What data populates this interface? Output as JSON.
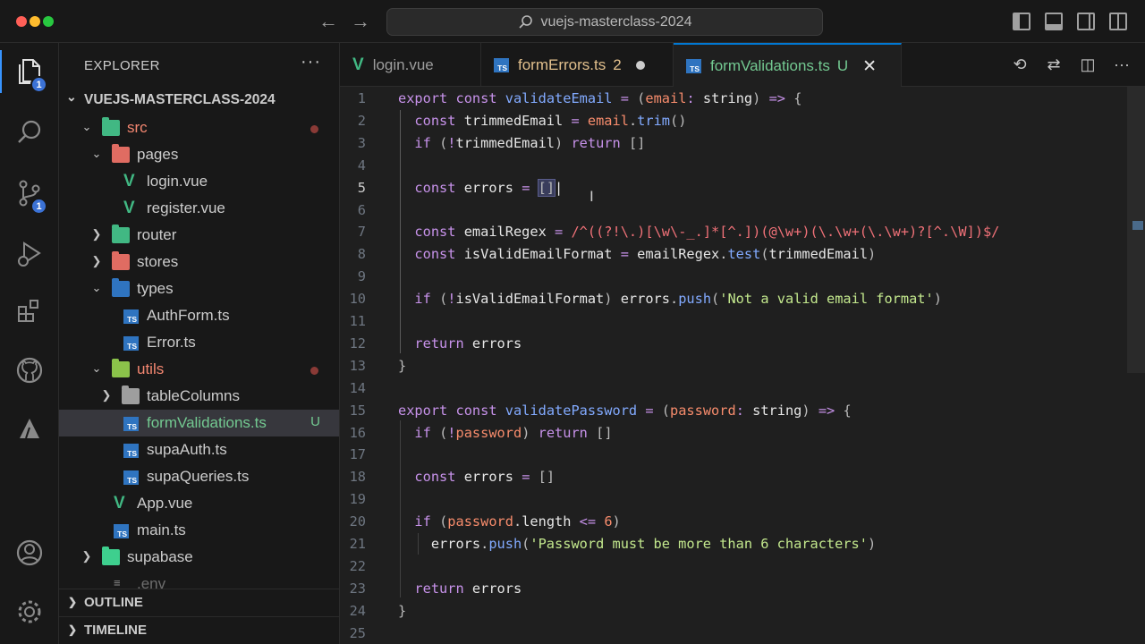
{
  "window": {
    "search_text": "vuejs-masterclass-2024"
  },
  "activity_bar": {
    "explorer_badge": "1",
    "scm_badge": "1"
  },
  "explorer": {
    "title": "EXPLORER",
    "more": "···",
    "root": "VUEJS-MASTERCLASS-2024",
    "items": [
      {
        "label": "src",
        "kind": "folder",
        "expanded": true,
        "color": "#f48771",
        "icon_color": "#41b883"
      },
      {
        "label": "pages",
        "kind": "folder",
        "expanded": true,
        "color": "#cccccc",
        "icon_color": "#e06c62"
      },
      {
        "label": "login.vue",
        "kind": "vue"
      },
      {
        "label": "register.vue",
        "kind": "vue"
      },
      {
        "label": "router",
        "kind": "folder",
        "expanded": false,
        "icon_color": "#41b883"
      },
      {
        "label": "stores",
        "kind": "folder",
        "expanded": false,
        "icon_color": "#e06c62"
      },
      {
        "label": "types",
        "kind": "folder",
        "expanded": true,
        "icon_color": "#2f74c0"
      },
      {
        "label": "AuthForm.ts",
        "kind": "ts"
      },
      {
        "label": "Error.ts",
        "kind": "ts"
      },
      {
        "label": "utils",
        "kind": "folder",
        "expanded": true,
        "color": "#f48771",
        "icon_color": "#8bc34a"
      },
      {
        "label": "tableColumns",
        "kind": "folder",
        "expanded": false,
        "icon_color": "#9e9e9e"
      },
      {
        "label": "formValidations.ts",
        "kind": "ts",
        "status": "U",
        "selected": true
      },
      {
        "label": "supaAuth.ts",
        "kind": "ts"
      },
      {
        "label": "supaQueries.ts",
        "kind": "ts"
      },
      {
        "label": "App.vue",
        "kind": "vue"
      },
      {
        "label": "main.ts",
        "kind": "ts"
      },
      {
        "label": "supabase",
        "kind": "folder",
        "expanded": false,
        "icon_color": "#3ecf8e"
      },
      {
        "label": ".env",
        "kind": "env"
      }
    ],
    "outline": "OUTLINE",
    "timeline": "TIMELINE"
  },
  "tabs": [
    {
      "label": "login.vue",
      "kind": "vue"
    },
    {
      "label": "formErrors.ts",
      "kind": "ts",
      "count": "2"
    },
    {
      "label": "formValidations.ts",
      "kind": "ts",
      "status": "U",
      "active": true
    }
  ],
  "code": {
    "current_line": 5,
    "line_numbers": [
      "1",
      "2",
      "3",
      "4",
      "5",
      "6",
      "7",
      "8",
      "9",
      "10",
      "11",
      "12",
      "13",
      "14",
      "15",
      "16",
      "17",
      "18",
      "19",
      "20",
      "21",
      "22",
      "23",
      "24",
      "25"
    ]
  }
}
